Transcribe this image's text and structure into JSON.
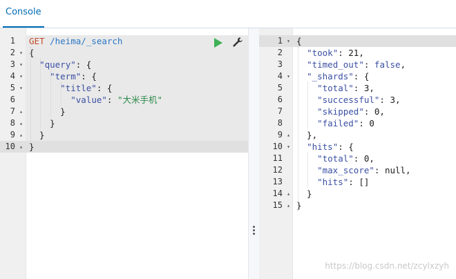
{
  "tab": {
    "label": "Console"
  },
  "request": {
    "lines": [
      {
        "n": "1",
        "fold": "",
        "parts": [
          {
            "c": "m",
            "t": "GET"
          },
          {
            "c": "u",
            "t": " /heima/_search"
          }
        ]
      },
      {
        "n": "2",
        "fold": "▾",
        "parts": [
          {
            "c": "n",
            "t": "{"
          }
        ]
      },
      {
        "n": "3",
        "fold": "▾",
        "parts": [
          {
            "c": "n",
            "t": "  "
          },
          {
            "c": "k",
            "t": "\"query\""
          },
          {
            "c": "n",
            "t": ": {"
          }
        ]
      },
      {
        "n": "4",
        "fold": "▾",
        "parts": [
          {
            "c": "n",
            "t": "    "
          },
          {
            "c": "k",
            "t": "\"term\""
          },
          {
            "c": "n",
            "t": ": {"
          }
        ]
      },
      {
        "n": "5",
        "fold": "▾",
        "parts": [
          {
            "c": "n",
            "t": "      "
          },
          {
            "c": "k",
            "t": "\"title\""
          },
          {
            "c": "n",
            "t": ": {"
          }
        ]
      },
      {
        "n": "6",
        "fold": "",
        "parts": [
          {
            "c": "n",
            "t": "        "
          },
          {
            "c": "k",
            "t": "\"value\""
          },
          {
            "c": "n",
            "t": ": "
          },
          {
            "c": "s",
            "t": "\"大米手机\""
          }
        ]
      },
      {
        "n": "7",
        "fold": "▴",
        "parts": [
          {
            "c": "n",
            "t": "      }"
          }
        ]
      },
      {
        "n": "8",
        "fold": "▴",
        "parts": [
          {
            "c": "n",
            "t": "    }"
          }
        ]
      },
      {
        "n": "9",
        "fold": "▴",
        "parts": [
          {
            "c": "n",
            "t": "  }"
          }
        ]
      },
      {
        "n": "10",
        "fold": "▴",
        "parts": [
          {
            "c": "n",
            "t": "}"
          }
        ]
      }
    ]
  },
  "response": {
    "lines": [
      {
        "n": "1",
        "fold": "▾",
        "parts": [
          {
            "c": "n",
            "t": "{"
          }
        ]
      },
      {
        "n": "2",
        "fold": "",
        "parts": [
          {
            "c": "n",
            "t": "  "
          },
          {
            "c": "k",
            "t": "\"took\""
          },
          {
            "c": "n",
            "t": ": 21,"
          }
        ]
      },
      {
        "n": "3",
        "fold": "",
        "parts": [
          {
            "c": "n",
            "t": "  "
          },
          {
            "c": "k",
            "t": "\"timed_out\""
          },
          {
            "c": "n",
            "t": ": "
          },
          {
            "c": "b",
            "t": "false"
          },
          {
            "c": "n",
            "t": ","
          }
        ]
      },
      {
        "n": "4",
        "fold": "▾",
        "parts": [
          {
            "c": "n",
            "t": "  "
          },
          {
            "c": "k",
            "t": "\"_shards\""
          },
          {
            "c": "n",
            "t": ": {"
          }
        ]
      },
      {
        "n": "5",
        "fold": "",
        "parts": [
          {
            "c": "n",
            "t": "    "
          },
          {
            "c": "k",
            "t": "\"total\""
          },
          {
            "c": "n",
            "t": ": 3,"
          }
        ]
      },
      {
        "n": "6",
        "fold": "",
        "parts": [
          {
            "c": "n",
            "t": "    "
          },
          {
            "c": "k",
            "t": "\"successful\""
          },
          {
            "c": "n",
            "t": ": 3,"
          }
        ]
      },
      {
        "n": "7",
        "fold": "",
        "parts": [
          {
            "c": "n",
            "t": "    "
          },
          {
            "c": "k",
            "t": "\"skipped\""
          },
          {
            "c": "n",
            "t": ": 0,"
          }
        ]
      },
      {
        "n": "8",
        "fold": "",
        "parts": [
          {
            "c": "n",
            "t": "    "
          },
          {
            "c": "k",
            "t": "\"failed\""
          },
          {
            "c": "n",
            "t": ": 0"
          }
        ]
      },
      {
        "n": "9",
        "fold": "▴",
        "parts": [
          {
            "c": "n",
            "t": "  },"
          }
        ]
      },
      {
        "n": "10",
        "fold": "▾",
        "parts": [
          {
            "c": "n",
            "t": "  "
          },
          {
            "c": "k",
            "t": "\"hits\""
          },
          {
            "c": "n",
            "t": ": {"
          }
        ]
      },
      {
        "n": "11",
        "fold": "",
        "parts": [
          {
            "c": "n",
            "t": "    "
          },
          {
            "c": "k",
            "t": "\"total\""
          },
          {
            "c": "n",
            "t": ": 0,"
          }
        ]
      },
      {
        "n": "12",
        "fold": "",
        "parts": [
          {
            "c": "n",
            "t": "    "
          },
          {
            "c": "k",
            "t": "\"max_score\""
          },
          {
            "c": "n",
            "t": ": null,"
          }
        ]
      },
      {
        "n": "13",
        "fold": "",
        "parts": [
          {
            "c": "n",
            "t": "    "
          },
          {
            "c": "k",
            "t": "\"hits\""
          },
          {
            "c": "n",
            "t": ": []"
          }
        ]
      },
      {
        "n": "14",
        "fold": "▴",
        "parts": [
          {
            "c": "n",
            "t": "  }"
          }
        ]
      },
      {
        "n": "15",
        "fold": "▴",
        "parts": [
          {
            "c": "n",
            "t": "}"
          }
        ]
      }
    ]
  },
  "watermark": "https://blog.csdn.net/zcylxzyh",
  "colors": {
    "accent": "#006bb4",
    "play": "#3fb157"
  }
}
